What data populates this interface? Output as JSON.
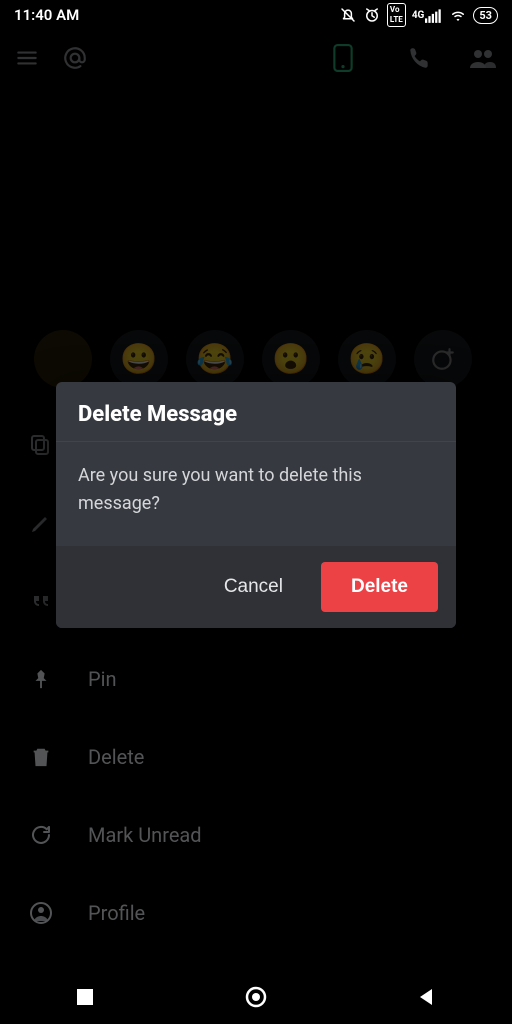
{
  "status": {
    "time": "11:40 AM",
    "battery": "53"
  },
  "dialog": {
    "title": "Delete Message",
    "body": "Are you sure you want to delete this message?",
    "cancel_label": "Cancel",
    "delete_label": "Delete"
  },
  "menu": {
    "pin": "Pin",
    "delete": "Delete",
    "mark_unread": "Mark Unread",
    "profile": "Profile"
  },
  "colors": {
    "danger": "#ed4245",
    "surface": "#36393f",
    "surface_alt": "#2f3136"
  }
}
